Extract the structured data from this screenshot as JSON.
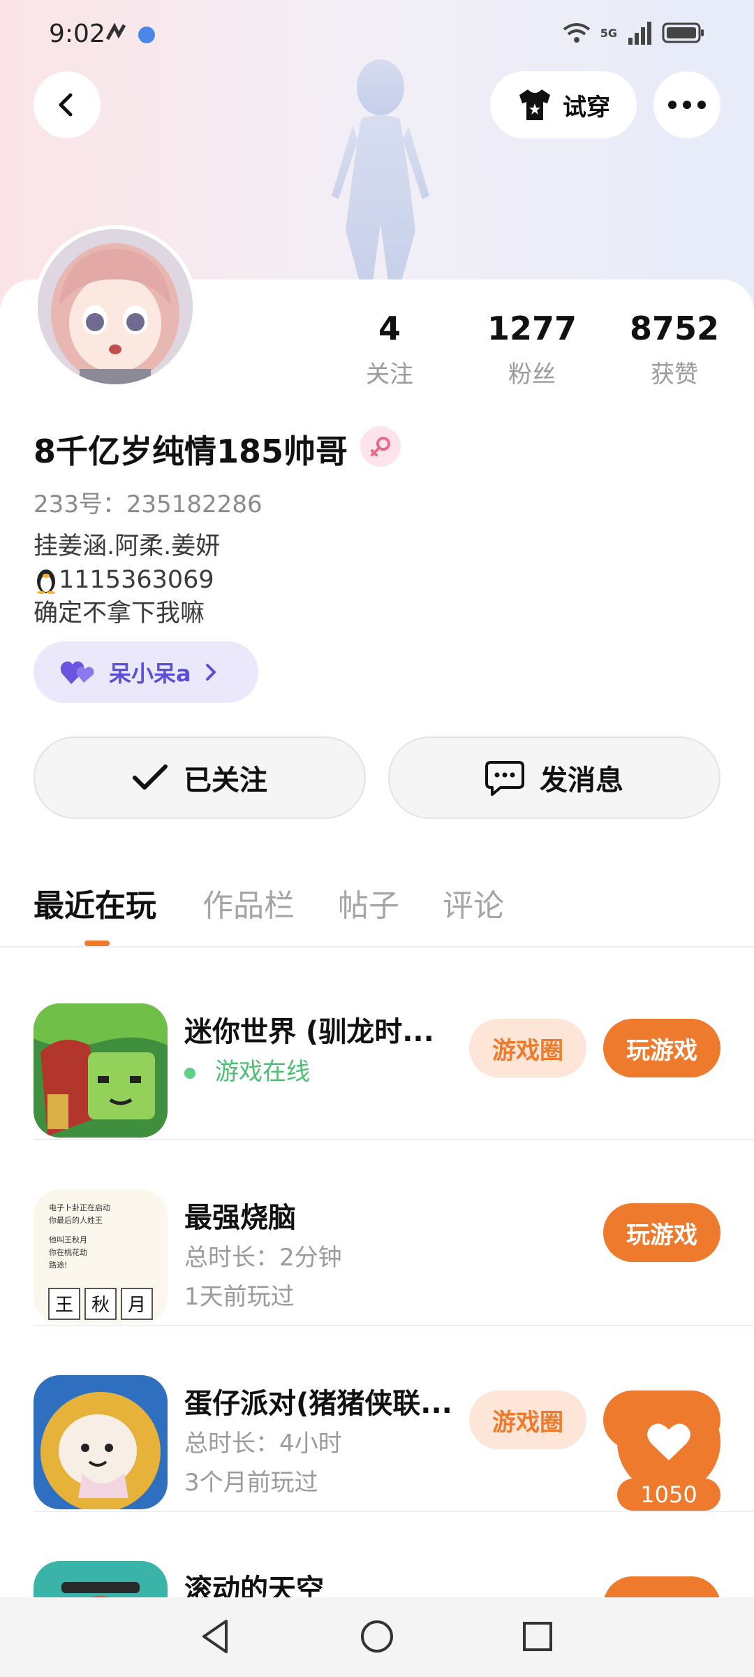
{
  "status_bar": {
    "time": "9:02",
    "network": "5G"
  },
  "header": {
    "tryon_label": "试穿"
  },
  "profile": {
    "nickname": "8千亿岁纯情185帅哥",
    "uid": "233号：235182286",
    "bio": [
      "挂姜涵.阿柔.姜妍",
      "1115363069",
      "确定不拿下我嘛"
    ],
    "relation_chip": "呆小呆a"
  },
  "stats": [
    {
      "value": "4",
      "label": "关注"
    },
    {
      "value": "1277",
      "label": "粉丝"
    },
    {
      "value": "8752",
      "label": "获赞"
    }
  ],
  "actions": {
    "follow_label": "已关注",
    "message_label": "发消息"
  },
  "tabs": [
    "最近在玩",
    "作品栏",
    "帖子",
    "评论"
  ],
  "games": [
    {
      "title": "迷你世界 (驯龙时...",
      "status": "游戏在线",
      "circle": "游戏圈",
      "play": "玩游戏"
    },
    {
      "title": "最强烧脑",
      "duration": "总时长：2分钟",
      "last_played": "1天前玩过",
      "play": "玩游戏",
      "icon_text": [
        "电子卜卦正在启动",
        "你最后的人姓王",
        "他叫王秋月",
        "你在桃花劫",
        "路途!"
      ],
      "icon_chars": [
        "王",
        "秋",
        "月"
      ]
    },
    {
      "title": "蛋仔派对(猪猪侠联...",
      "duration": "总时长：4小时",
      "last_played": "3个月前玩过",
      "circle": "游戏圈",
      "play": "玩游戏"
    },
    {
      "title": "滚动的天空"
    }
  ],
  "like_fab": {
    "count": "1050"
  },
  "colors": {
    "accent": "#ee7a2e",
    "accent_light": "#fde5d8",
    "online": "#4cbf72",
    "chip_purple": "#5b4fd8"
  }
}
